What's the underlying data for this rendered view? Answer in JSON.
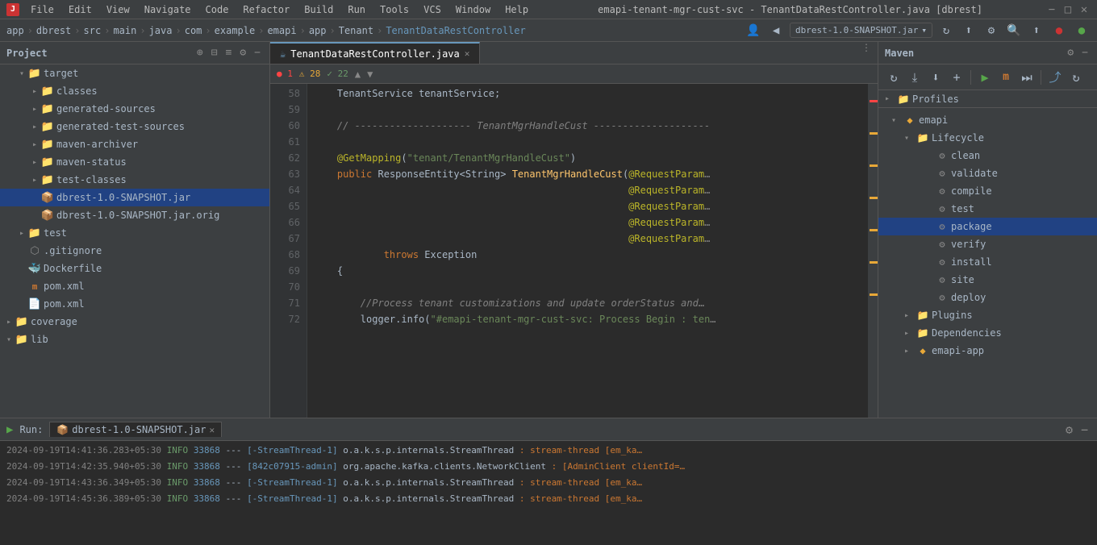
{
  "window": {
    "title": "emapi-tenant-mgr-cust-svc - TenantDataRestController.java [dbrest]",
    "app_icon": "J"
  },
  "menu": {
    "items": [
      "File",
      "Edit",
      "View",
      "Navigate",
      "Code",
      "Refactor",
      "Build",
      "Run",
      "Tools",
      "VCS",
      "Window",
      "Help"
    ]
  },
  "breadcrumb": {
    "items": [
      "app",
      "dbrest",
      "src",
      "main",
      "java",
      "com",
      "example",
      "emapi",
      "app",
      "Tenant",
      "TenantDataRestController"
    ],
    "jar": "dbrest-1.0-SNAPSHOT.jar"
  },
  "project": {
    "title": "Project",
    "tree": [
      {
        "id": "target",
        "label": "target",
        "type": "folder",
        "indent": 1,
        "expanded": true
      },
      {
        "id": "classes",
        "label": "classes",
        "type": "folder",
        "indent": 2,
        "expanded": false
      },
      {
        "id": "generated-sources",
        "label": "generated-sources",
        "type": "folder",
        "indent": 2,
        "expanded": false
      },
      {
        "id": "generated-test-sources",
        "label": "generated-test-sources",
        "type": "folder",
        "indent": 2,
        "expanded": false
      },
      {
        "id": "maven-archiver",
        "label": "maven-archiver",
        "type": "folder",
        "indent": 2,
        "expanded": false
      },
      {
        "id": "maven-status",
        "label": "maven-status",
        "type": "folder",
        "indent": 2,
        "expanded": false
      },
      {
        "id": "test-classes",
        "label": "test-classes",
        "type": "folder",
        "indent": 2,
        "expanded": false
      },
      {
        "id": "jar1",
        "label": "dbrest-1.0-SNAPSHOT.jar",
        "type": "jar",
        "indent": 2,
        "selected": true
      },
      {
        "id": "jar2",
        "label": "dbrest-1.0-SNAPSHOT.jar.orig",
        "type": "jar",
        "indent": 2
      },
      {
        "id": "test",
        "label": "test",
        "type": "folder",
        "indent": 1,
        "expanded": false
      },
      {
        "id": "gitignore",
        "label": ".gitignore",
        "type": "git",
        "indent": 1
      },
      {
        "id": "dockerfile",
        "label": "Dockerfile",
        "type": "docker",
        "indent": 1
      },
      {
        "id": "pomm",
        "label": "pom.xml",
        "type": "xml_m",
        "indent": 1
      },
      {
        "id": "pom",
        "label": "pom.xml",
        "type": "xml",
        "indent": 1
      },
      {
        "id": "coverage",
        "label": "coverage",
        "type": "folder",
        "indent": 0,
        "expanded": false
      },
      {
        "id": "lib",
        "label": "lib",
        "type": "folder",
        "indent": 0,
        "expanded": true
      }
    ]
  },
  "editor": {
    "tab": "TenantDataRestController.java",
    "error_count": 1,
    "warning_count": 28,
    "ok_count": 22,
    "lines": [
      {
        "num": 58,
        "tokens": [
          {
            "t": "    TenantService ",
            "c": "type"
          },
          {
            "t": "tenantService",
            "c": "param"
          },
          {
            "t": ";",
            "c": ""
          }
        ]
      },
      {
        "num": 59,
        "tokens": []
      },
      {
        "num": 60,
        "tokens": [
          {
            "t": "    ",
            "c": ""
          },
          {
            "t": "// -------------------- TenantMgrHandleCust --------------------",
            "c": "comment"
          }
        ]
      },
      {
        "num": 61,
        "tokens": []
      },
      {
        "num": 62,
        "tokens": [
          {
            "t": "    ",
            "c": ""
          },
          {
            "t": "@GetMapping",
            "c": "ann"
          },
          {
            "t": "(\"tenant/TenantMgrHandleCust\")",
            "c": "str"
          }
        ]
      },
      {
        "num": 63,
        "tokens": [
          {
            "t": "    ",
            "c": ""
          },
          {
            "t": "public",
            "c": "kw"
          },
          {
            "t": " ",
            "c": ""
          },
          {
            "t": "ResponseEntity",
            "c": "type"
          },
          {
            "t": "<",
            "c": ""
          },
          {
            "t": "String",
            "c": "type"
          },
          {
            "t": "> ",
            "c": ""
          },
          {
            "t": "TenantMgrHandleCust",
            "c": "func"
          },
          {
            "t": "(@RequestParam",
            "c": "ann"
          },
          {
            "t": "…",
            "c": ""
          }
        ]
      },
      {
        "num": 64,
        "tokens": [
          {
            "t": "                                                      ",
            "c": ""
          },
          {
            "t": "@RequestParam",
            "c": "ann"
          },
          {
            "t": "…",
            "c": ""
          }
        ]
      },
      {
        "num": 65,
        "tokens": [
          {
            "t": "                                                      ",
            "c": ""
          },
          {
            "t": "@RequestParam",
            "c": "ann"
          },
          {
            "t": "…",
            "c": ""
          }
        ]
      },
      {
        "num": 66,
        "tokens": [
          {
            "t": "                                                      ",
            "c": ""
          },
          {
            "t": "@RequestParam",
            "c": "ann"
          },
          {
            "t": "…",
            "c": ""
          }
        ]
      },
      {
        "num": 67,
        "tokens": [
          {
            "t": "                                                      ",
            "c": ""
          },
          {
            "t": "@RequestParam",
            "c": "ann"
          },
          {
            "t": "…",
            "c": ""
          }
        ]
      },
      {
        "num": 68,
        "tokens": [
          {
            "t": "            ",
            "c": ""
          },
          {
            "t": "throws",
            "c": "kw"
          },
          {
            "t": " Exception",
            "c": "type"
          }
        ]
      },
      {
        "num": 69,
        "tokens": [
          {
            "t": "    {",
            "c": ""
          }
        ]
      },
      {
        "num": 70,
        "tokens": []
      },
      {
        "num": 71,
        "tokens": [
          {
            "t": "        ",
            "c": ""
          },
          {
            "t": "//Process tenant customizations and update orderStatus and",
            "c": "comment"
          },
          {
            "t": "…",
            "c": "comment"
          }
        ]
      },
      {
        "num": 72,
        "tokens": [
          {
            "t": "        ",
            "c": ""
          },
          {
            "t": "logger.info(",
            "c": ""
          },
          {
            "t": "\"#emapi-tenant-mgr-cust-svc: Process Begin : ten",
            "c": "str"
          },
          {
            "t": "…",
            "c": ""
          }
        ]
      }
    ]
  },
  "maven": {
    "title": "Maven",
    "profiles_label": "Profiles",
    "sections": [
      {
        "id": "emapi",
        "label": "emapi",
        "type": "module",
        "indent": 0,
        "expanded": true
      },
      {
        "id": "lifecycle",
        "label": "Lifecycle",
        "type": "folder",
        "indent": 1,
        "expanded": true
      },
      {
        "id": "clean",
        "label": "clean",
        "type": "gear",
        "indent": 2
      },
      {
        "id": "validate",
        "label": "validate",
        "type": "gear",
        "indent": 2
      },
      {
        "id": "compile",
        "label": "compile",
        "type": "gear",
        "indent": 2
      },
      {
        "id": "test",
        "label": "test",
        "type": "gear",
        "indent": 2
      },
      {
        "id": "package",
        "label": "package",
        "type": "gear",
        "indent": 2,
        "selected": true
      },
      {
        "id": "verify",
        "label": "verify",
        "type": "gear",
        "indent": 2
      },
      {
        "id": "install",
        "label": "install",
        "type": "gear",
        "indent": 2
      },
      {
        "id": "site",
        "label": "site",
        "type": "gear",
        "indent": 2
      },
      {
        "id": "deploy",
        "label": "deploy",
        "type": "gear",
        "indent": 2
      },
      {
        "id": "plugins",
        "label": "Plugins",
        "type": "folder",
        "indent": 1,
        "expanded": false
      },
      {
        "id": "dependencies",
        "label": "Dependencies",
        "type": "folder",
        "indent": 1,
        "expanded": false
      },
      {
        "id": "emapi-app",
        "label": "emapi-app",
        "type": "module",
        "indent": 1,
        "expanded": false
      }
    ]
  },
  "run": {
    "label": "Run:",
    "tab": "dbrest-1.0-SNAPSHOT.jar",
    "logs": [
      {
        "timestamp": "2024-09-19T14:41:36.283+05:30",
        "level": "INFO",
        "thread": "33868",
        "sep1": "---",
        "bracket": "[-StreamThread-1]",
        "logger": "o.a.k.s.p.internals.StreamThread",
        "msg": ": stream-thread [em_ka…"
      },
      {
        "timestamp": "2024-09-19T14:42:35.940+05:30",
        "level": "INFO",
        "thread": "33868",
        "sep1": "---",
        "bracket": "[842c07915-admin]",
        "logger": "org.apache.kafka.clients.NetworkClient",
        "msg": ": [AdminClient clientId=…"
      },
      {
        "timestamp": "2024-09-19T14:43:36.349+05:30",
        "level": "INFO",
        "thread": "33868",
        "sep1": "---",
        "bracket": "[-StreamThread-1]",
        "logger": "o.a.k.s.p.internals.StreamThread",
        "msg": ": stream-thread [em_ka…"
      },
      {
        "timestamp": "2024-09-19T14:45:36.389+05:30",
        "level": "INFO",
        "thread": "33868",
        "sep1": "---",
        "bracket": "[-StreamThread-1]",
        "logger": "o.a.k.s.p.internals.StreamThread",
        "msg": ": stream-thread [em_ka…"
      }
    ]
  },
  "icons": {
    "refresh": "↺",
    "sync": "⇄",
    "download": "⬇",
    "add": "+",
    "run": "▶",
    "maven": "M",
    "skip": "⏭",
    "expand": "▸",
    "collapse": "▾",
    "settings": "⚙",
    "close": "✕",
    "minus": "−",
    "search": "🔍",
    "back": "←",
    "forward": "→",
    "up": "⬆",
    "nav_left": "◀",
    "nav_right": "▶",
    "chevron_right": "▸",
    "chevron_down": "▾"
  }
}
